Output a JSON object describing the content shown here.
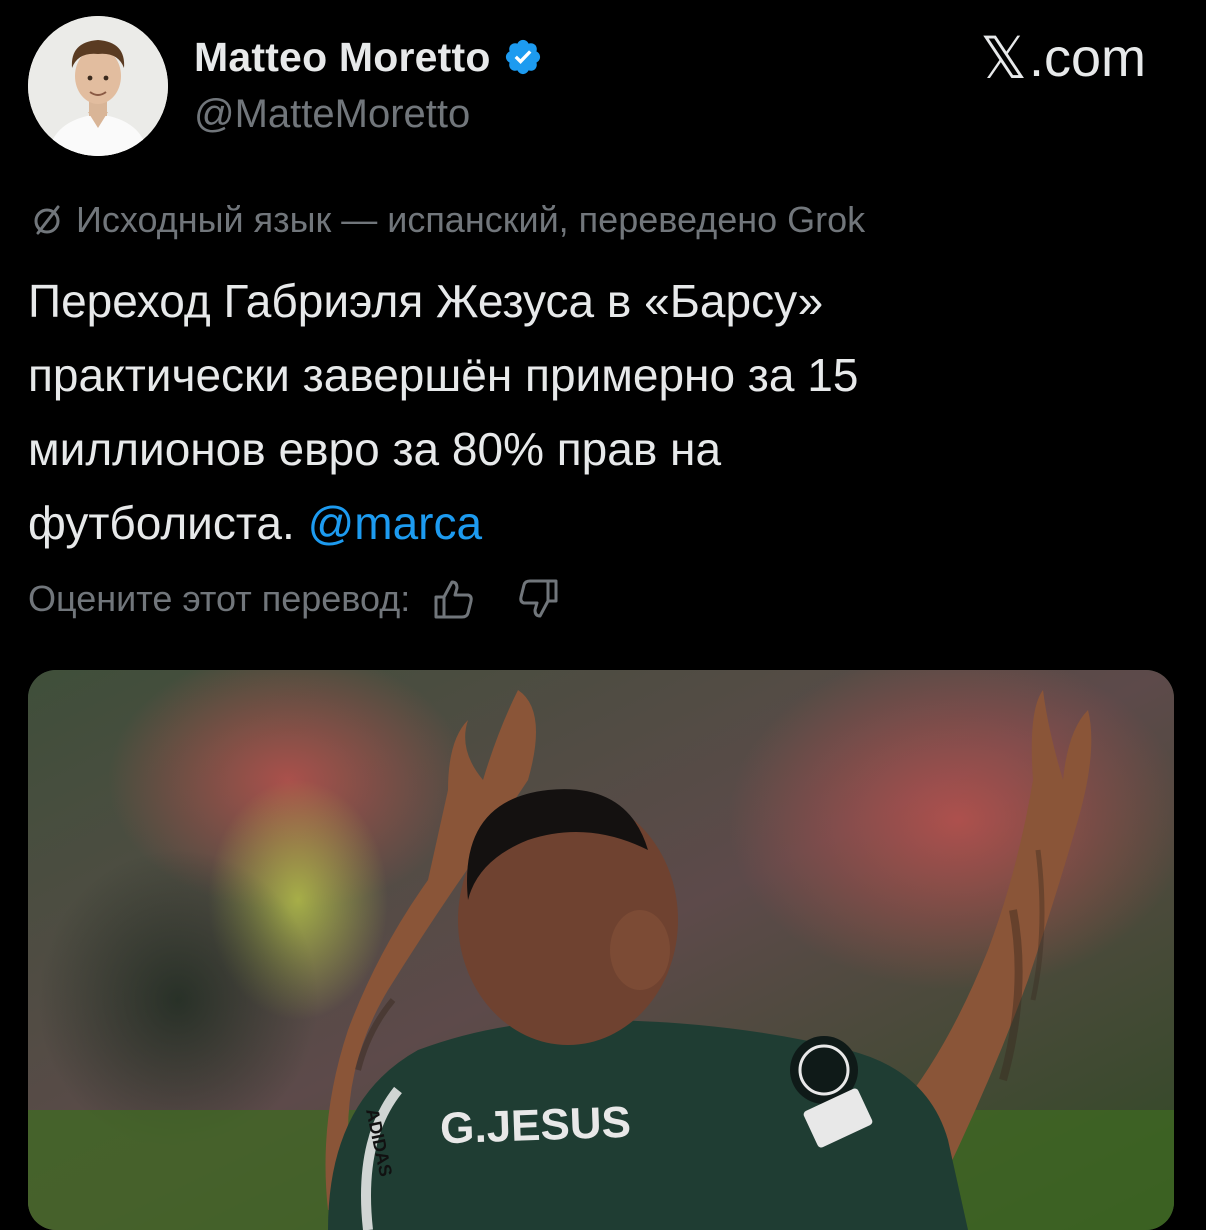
{
  "author": {
    "name": "Matteo Moretto",
    "handle": "@MatteMoretto",
    "verified": true,
    "avatar_icon": "profile-photo"
  },
  "brand": {
    "x_glyph": "𝕏",
    "domain": ".com"
  },
  "translation": {
    "icon": "translate-icon",
    "note": "Исходный язык — испанский, переведено Grok"
  },
  "tweet": {
    "lines": [
      "Переход Габриэля Жезуса в «Барсу»",
      "практически завершён примерно за 15",
      "миллионов евро за 80% прав на"
    ],
    "last_line_text": "футболиста.",
    "mention": "@marca"
  },
  "rating": {
    "label": "Оцените этот перевод:",
    "up_icon": "thumbs-up-icon",
    "down_icon": "thumbs-down-icon"
  },
  "media": {
    "jersey_text": "G.JESUS",
    "sleeve_text": "ADIDAS"
  },
  "colors": {
    "background": "#000000",
    "text_primary": "#e7e9ea",
    "text_secondary": "#71767b",
    "link": "#1d9bf0",
    "verified": "#1d9bf0"
  }
}
